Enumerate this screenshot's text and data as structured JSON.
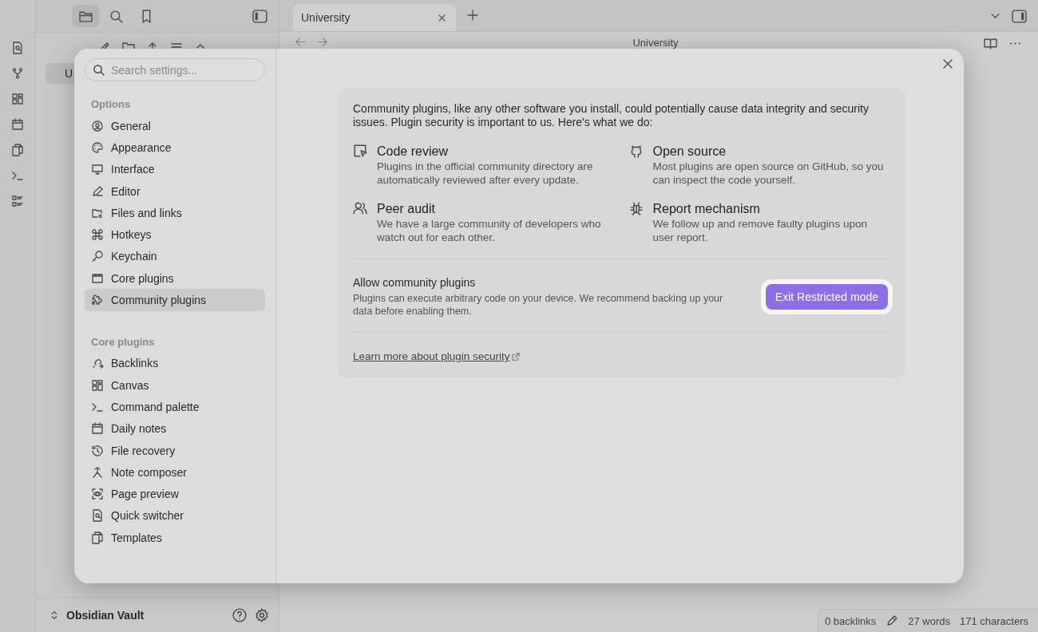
{
  "sidebar": {
    "tabs": [
      {
        "selected": true
      },
      {
        "selected": false
      },
      {
        "selected": false
      }
    ],
    "file_tree": [
      {
        "label": "U",
        "selected": true
      }
    ],
    "vault": {
      "name": "Obsidian Vault"
    }
  },
  "tabs": [
    {
      "label": "University",
      "selected": true
    }
  ],
  "view_header": {
    "title": "University"
  },
  "status_bar": [
    "0 backlinks",
    "27 words",
    "171 characters"
  ],
  "settings": {
    "search": {
      "placeholder": "Search settings..."
    },
    "groups": [
      {
        "heading": "Options",
        "items": [
          {
            "label": "General",
            "selected": false
          },
          {
            "label": "Appearance",
            "selected": false
          },
          {
            "label": "Interface",
            "selected": false
          },
          {
            "label": "Editor",
            "selected": false
          },
          {
            "label": "Files and links",
            "selected": false
          },
          {
            "label": "Hotkeys",
            "selected": false
          },
          {
            "label": "Keychain",
            "selected": false
          },
          {
            "label": "Core plugins",
            "selected": false
          },
          {
            "label": "Community plugins",
            "selected": true
          }
        ]
      },
      {
        "heading": "Core plugins",
        "items": [
          {
            "label": "Backlinks",
            "selected": false
          },
          {
            "label": "Canvas",
            "selected": false
          },
          {
            "label": "Command palette",
            "selected": false
          },
          {
            "label": "Daily notes",
            "selected": false
          },
          {
            "label": "File recovery",
            "selected": false
          },
          {
            "label": "Note composer",
            "selected": false
          },
          {
            "label": "Page preview",
            "selected": false
          },
          {
            "label": "Quick switcher",
            "selected": false
          },
          {
            "label": "Templates",
            "selected": false
          }
        ]
      }
    ],
    "intro": "Community plugins, like any other software you install, could potentially cause data integrity and security issues. Plugin security is important to us. Here's what we do:",
    "features": [
      {
        "title": "Code review",
        "description": "Plugins in the official community directory are automatically reviewed after every update."
      },
      {
        "title": "Open source",
        "description": "Most plugins are open source on GitHub, so you can inspect the code yourself."
      },
      {
        "title": "Peer audit",
        "description": "We have a large community of developers who watch out for each other."
      },
      {
        "title": "Report mechanism",
        "description": "We follow up and remove faulty plugins upon user report."
      }
    ],
    "setting": {
      "name": "Allow community plugins",
      "description": "Plugins can execute arbitrary code on your device. We recommend backing up your data before enabling them.",
      "button": "Exit Restricted mode"
    },
    "link": "Learn more about plugin security"
  }
}
